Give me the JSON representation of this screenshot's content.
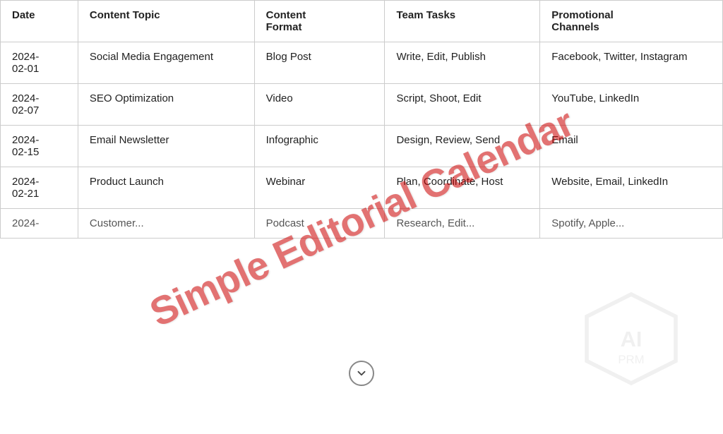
{
  "title": "Simple Editorial Calendar",
  "watermark": "Simple Editorial Calendar",
  "columns": [
    {
      "key": "date",
      "label": "Date"
    },
    {
      "key": "topic",
      "label": "Content Topic"
    },
    {
      "key": "format",
      "label": "Content Format"
    },
    {
      "key": "tasks",
      "label": "Team Tasks"
    },
    {
      "key": "channels",
      "label": "Promotional Channels"
    }
  ],
  "rows": [
    {
      "date": "2024-\n02-01",
      "topic": "Social Media Engagement",
      "format": "Blog Post",
      "tasks": "Write, Edit, Publish",
      "channels": "Facebook, Twitter, Instagram"
    },
    {
      "date": "2024-\n02-07",
      "topic": "SEO Optimization",
      "format": "Video",
      "tasks": "Script, Shoot, Edit",
      "channels": "YouTube, LinkedIn"
    },
    {
      "date": "2024-\n02-15",
      "topic": "Email Newsletter",
      "format": "Infographic",
      "tasks": "Design, Review, Send",
      "channels": "Email"
    },
    {
      "date": "2024-\n02-21",
      "topic": "Product Launch",
      "format": "Webinar",
      "tasks": "Plan, Coordinate, Host",
      "channels": "Website, Email, LinkedIn"
    },
    {
      "date": "2024-",
      "topic": "Customer...",
      "format": "Podcast",
      "tasks": "Research, Edit...",
      "channels": "Spotify, Apple..."
    }
  ],
  "scroll_button": "↓"
}
